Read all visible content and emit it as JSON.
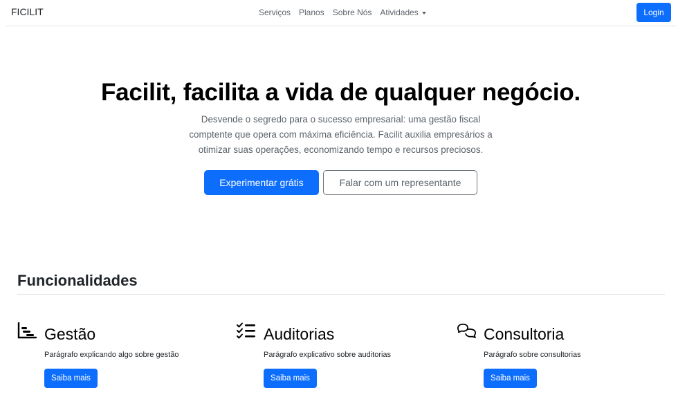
{
  "navbar": {
    "brand": "FICILIT",
    "links": [
      "Serviços",
      "Planos",
      "Sobre Nós"
    ],
    "dropdown_label": "Atividades",
    "login_label": "Login"
  },
  "hero": {
    "title": "Facilit, facilita a vida de qualquer negócio.",
    "description": "Desvende o segredo para o sucesso empresarial: uma gestão fiscal comptente que opera com máxima eficiência. Facilit auxilia empresários a otimizar suas operações, economizando tempo e recursos preciosos.",
    "primary_cta": "Experimentar grátis",
    "secondary_cta": "Falar com um representante"
  },
  "features": {
    "title": "Funcionalidades",
    "items": [
      {
        "icon": "bar-chart-steps-icon",
        "title": "Gestão",
        "text": "Parágrafo explicando algo sobre gestão",
        "button": "Saiba mais"
      },
      {
        "icon": "checklist-icon",
        "title": "Auditorias",
        "text": "Parágrafo explicativo sobre auditorias",
        "button": "Saiba mais"
      },
      {
        "icon": "chat-bubbles-icon",
        "title": "Consultoria",
        "text": "Parágrafo sobre consultorias",
        "button": "Saiba mais"
      }
    ]
  },
  "colors": {
    "primary": "#0d6efd",
    "muted": "#5c636a",
    "border": "#dee2e6"
  }
}
